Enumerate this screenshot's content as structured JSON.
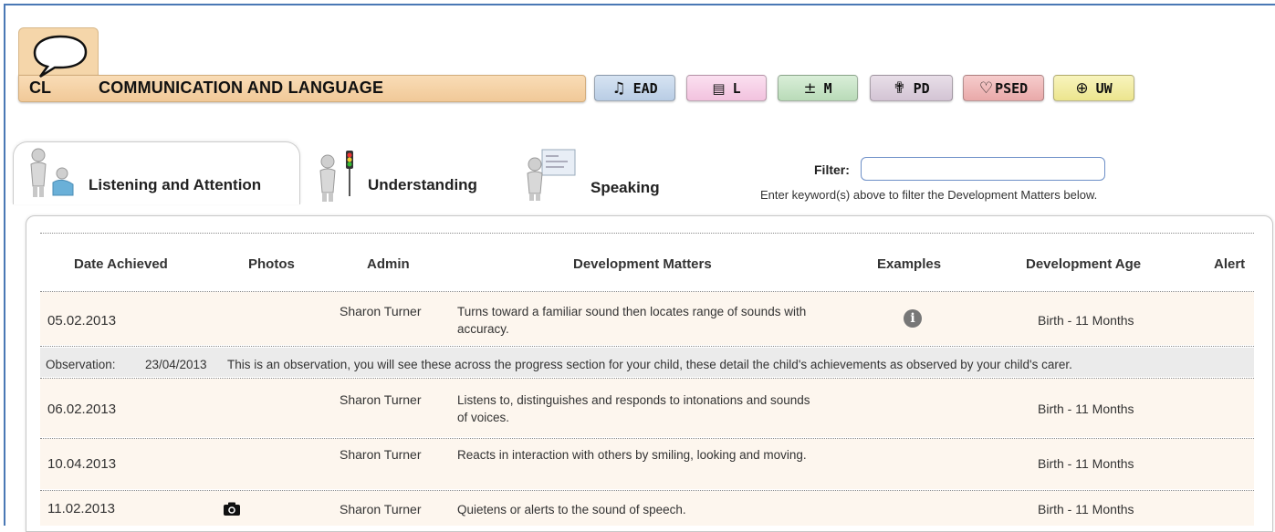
{
  "category": {
    "code": "CL",
    "title": "COMMUNICATION AND LANGUAGE",
    "icon": "speech-bubble-icon"
  },
  "area_buttons": [
    {
      "label": "EAD",
      "icon": "music-note-icon",
      "glyph": "♫",
      "color": "#c5d6ea"
    },
    {
      "label": "L",
      "icon": "open-book-icon",
      "glyph": "📖",
      "color": "#f6cfe6"
    },
    {
      "label": "M",
      "icon": "plus-minus-icon",
      "glyph": "±",
      "color": "#c7e3c6"
    },
    {
      "label": "PD",
      "icon": "running-figure-icon",
      "glyph": "🏃",
      "color": "#ddd0de"
    },
    {
      "label": "PSED",
      "icon": "heart-icon",
      "glyph": "♡",
      "color": "#efb8b8"
    },
    {
      "label": "UW",
      "icon": "globe-icon",
      "glyph": "⊕",
      "color": "#f4efa6"
    }
  ],
  "subtabs": [
    {
      "label": "Listening and Attention",
      "icon": "listening-figure-icon",
      "active": true
    },
    {
      "label": "Understanding",
      "icon": "traffic-light-figure-icon",
      "active": false
    },
    {
      "label": "Speaking",
      "icon": "presenting-figure-icon",
      "active": false
    }
  ],
  "filter": {
    "label": "Filter:",
    "value": "",
    "hint": "Enter keyword(s) above to filter the Development Matters below."
  },
  "table": {
    "headers": [
      "Date Achieved",
      "Photos",
      "Admin",
      "Development Matters",
      "Examples",
      "Development Age",
      "Alert"
    ],
    "rows": [
      {
        "date": "05.02.2013",
        "photo": false,
        "admin": "Sharon Turner",
        "dm": "Turns toward a familiar sound then locates range of sounds with accuracy.",
        "example": true,
        "age": "Birth - 11 Months"
      },
      {
        "date": "06.02.2013",
        "photo": false,
        "admin": "Sharon Turner",
        "dm": "Listens to, distinguishes and responds to intonations and sounds of voices.",
        "example": false,
        "age": "Birth - 11 Months"
      },
      {
        "date": "10.04.2013",
        "photo": false,
        "admin": "Sharon Turner",
        "dm": "Reacts in interaction with others by smiling, looking and moving.",
        "example": false,
        "age": "Birth - 11 Months"
      },
      {
        "date": "11.02.2013",
        "photo": true,
        "admin": "Sharon Turner",
        "dm": "Quietens or alerts to the sound of speech.",
        "example": false,
        "age": "Birth - 11 Months"
      }
    ],
    "observation": {
      "label": "Observation:",
      "date": "23/04/2013",
      "text": "This is an observation, you will see these across the progress section for your child, these detail the child's achievements as observed by your child's carer."
    }
  }
}
